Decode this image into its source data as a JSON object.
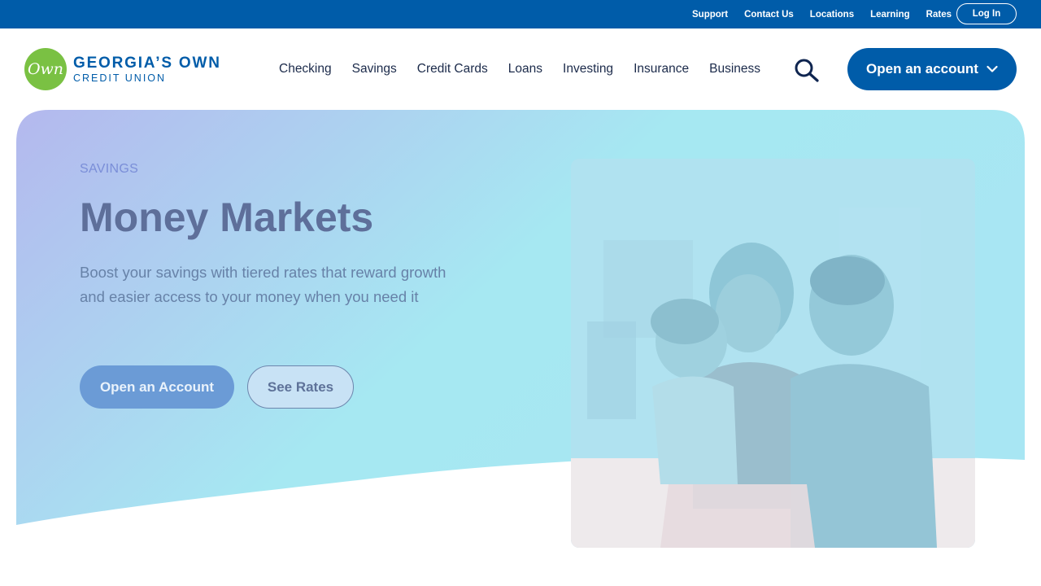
{
  "utility": {
    "links": [
      "Support",
      "Contact Us",
      "Locations",
      "Learning",
      "Rates"
    ],
    "login_label": "Log In"
  },
  "header": {
    "logo_badge": "Own",
    "logo_name": "GEORGIA’S OWN",
    "logo_sub": "CREDIT UNION",
    "nav": [
      "Checking",
      "Savings",
      "Credit Cards",
      "Loans",
      "Investing",
      "Insurance",
      "Business"
    ],
    "cta_label": "Open an account"
  },
  "hero": {
    "eyebrow": "SAVINGS",
    "title": "Money Markets",
    "description": "Boost your savings with tiered rates that reward growth and easier access to your money when you need it",
    "primary_button": "Open an Account",
    "secondary_button": "See Rates"
  },
  "colors": {
    "brand_blue": "#005ca9",
    "logo_green": "#7ac143",
    "gradient_start": "#b4b8ee",
    "gradient_end": "#a6e8f2"
  },
  "icons": {
    "search": "search-icon",
    "dropdown": "chevron-down-icon"
  }
}
